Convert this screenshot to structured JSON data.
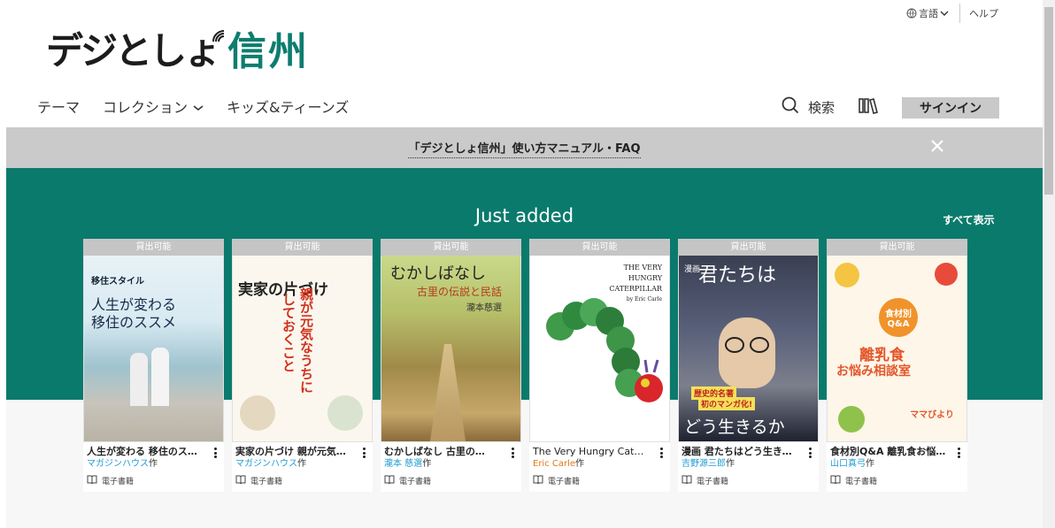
{
  "util": {
    "language_label": "言語",
    "help_label": "ヘルプ"
  },
  "logo": {
    "part1": "デジとしょ",
    "part2": "信州"
  },
  "nav": {
    "items": [
      {
        "label": "テーマ"
      },
      {
        "label": "コレクション",
        "has_dropdown": true
      },
      {
        "label": "キッズ&ティーンズ"
      }
    ],
    "search_label": "検索",
    "signin_label": "サインイン"
  },
  "banner": {
    "text": "「デジとしょ信州」使い方マニュアル・FAQ"
  },
  "section": {
    "title": "Just added",
    "see_all": "すべて表示"
  },
  "books": [
    {
      "badge": "貸出可能",
      "title": "人生が変わる 移住のススメ",
      "author": "マガジンハウス",
      "author_suffix": "作",
      "kind": "電子書籍",
      "cover_text": [
        "移住スタイル",
        "人生が変わる",
        "移住のススメ"
      ]
    },
    {
      "badge": "貸出可能",
      "title": "実家の片づけ 親が元気な…",
      "author": "マガジンハウス",
      "author_suffix": "作",
      "kind": "電子書籍",
      "cover_text": [
        "実家の片づけ",
        "親が元気なうちに",
        "しておくこと"
      ]
    },
    {
      "badge": "貸出可能",
      "title": "むかしばなし 古里の…",
      "author": "瀧本 慈選",
      "author_suffix": "作",
      "kind": "電子書籍",
      "cover_text": [
        "むかしばなし",
        "古里の伝説と民話",
        "瀧本慈選"
      ]
    },
    {
      "badge": "貸出可能",
      "title": "The Very Hungry Cate…",
      "author": "Eric Carle",
      "author_suffix": "作",
      "kind": "電子書籍",
      "cover_text": [
        "THE VERY",
        "HUNGRY",
        "CATERPILLAR",
        "by Eric Carle"
      ]
    },
    {
      "badge": "貸出可能",
      "title": "漫画 君たちはどう生きる…",
      "author": "吉野源三郎",
      "author_suffix": "作",
      "kind": "電子書籍",
      "cover_text": [
        "漫画",
        "君たちは",
        "どう生きるか",
        "歴史的名著",
        "初のマンガ化!"
      ]
    },
    {
      "badge": "貸出可能",
      "title": "食材別Q&A 離乳食お悩み…",
      "author": "山口真弓",
      "author_suffix": "作",
      "kind": "電子書籍",
      "cover_text": [
        "離乳食",
        "お悩み相談室",
        "食材別",
        "Q&A",
        "ママびより"
      ]
    }
  ],
  "colors": {
    "teal": "#0a7a6c",
    "link_blue": "#1f9bd3",
    "link_orange": "#e07a15"
  }
}
